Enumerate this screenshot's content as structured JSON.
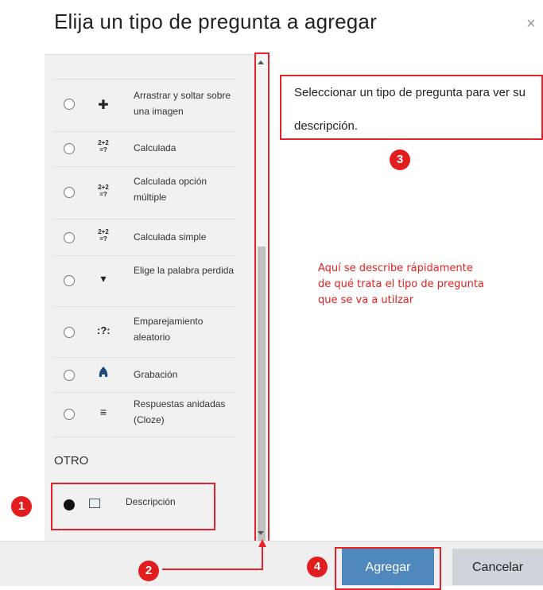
{
  "dialog": {
    "title": "Elija un tipo de pregunta a agregar",
    "close": "×"
  },
  "question_types": [
    {
      "label": "Arrastrar y soltar sobre una imagen",
      "icon": "move-cross-icon",
      "glyph": "✚"
    },
    {
      "label": "Calculada",
      "icon": "calculated-icon",
      "glyph": "2+2=?"
    },
    {
      "label": "Calculada opción múltiple",
      "icon": "calculated-multi-icon",
      "glyph": "2+2=?"
    },
    {
      "label": "Calculada simple",
      "icon": "calculated-simple-icon",
      "glyph": "2+2=?"
    },
    {
      "label": "Elige la palabra perdida",
      "icon": "caret-down-icon",
      "glyph": "▾"
    },
    {
      "label": "Emparejamiento aleatorio",
      "icon": "random-match-icon",
      "glyph": ":?:"
    },
    {
      "label": "Grabación",
      "icon": "recording-icon",
      "glyph": "●"
    },
    {
      "label": "Respuestas anidadas (Cloze)",
      "icon": "cloze-icon",
      "glyph": "≡"
    }
  ],
  "section_other": "OTRO",
  "selected_item": {
    "label": "Descripción",
    "icon": "description-icon"
  },
  "description_panel": {
    "text": "Seleccionar un tipo de pregunta para ver su descripción."
  },
  "annotation_note": "Aquí se describe rápidamente de qué trata el tipo de pregunta que se va a utilzar",
  "badges": [
    "1",
    "2",
    "3",
    "4"
  ],
  "buttons": {
    "add": "Agregar",
    "cancel": "Cancelar"
  },
  "colors": {
    "annotation_red": "#e8222a",
    "primary_button": "#4f88bd",
    "secondary_button": "#ced4da"
  }
}
